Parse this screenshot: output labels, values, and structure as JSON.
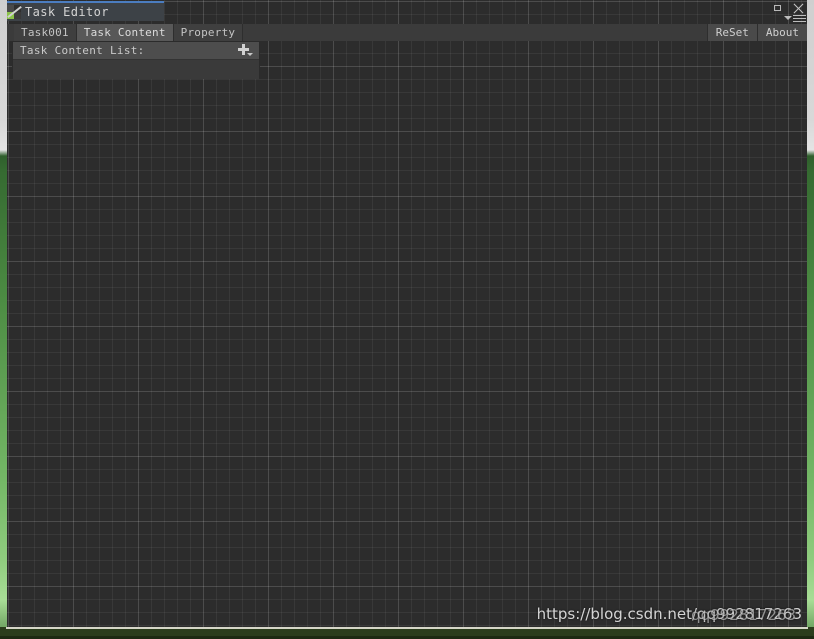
{
  "window": {
    "title": "Task Editor",
    "icon": "task-editor-icon",
    "buttons": {
      "maximize": "maximize-icon",
      "close": "close-icon",
      "menu": "hamburger-menu-icon"
    }
  },
  "toolbar": {
    "tabs": [
      {
        "label": "Task001",
        "state": "normal"
      },
      {
        "label": "Task Content",
        "state": "active"
      },
      {
        "label": "Property",
        "state": "normal"
      }
    ],
    "right_buttons": [
      {
        "label": "ReSet"
      },
      {
        "label": "About"
      }
    ]
  },
  "content_panel": {
    "header_label": "Task Content List:",
    "add_icon": "plus-icon",
    "items": []
  },
  "watermark": {
    "text": "https://blog.csdn.net/qq992817263",
    "overlay_text": "qq992817263"
  },
  "colors": {
    "titlebar_accent": "#4b7dc0",
    "frame_green": "#4c8c43",
    "grid_background": "#2c2c2c",
    "panel_background": "#3a3a3a",
    "tab_active": "#585858"
  }
}
